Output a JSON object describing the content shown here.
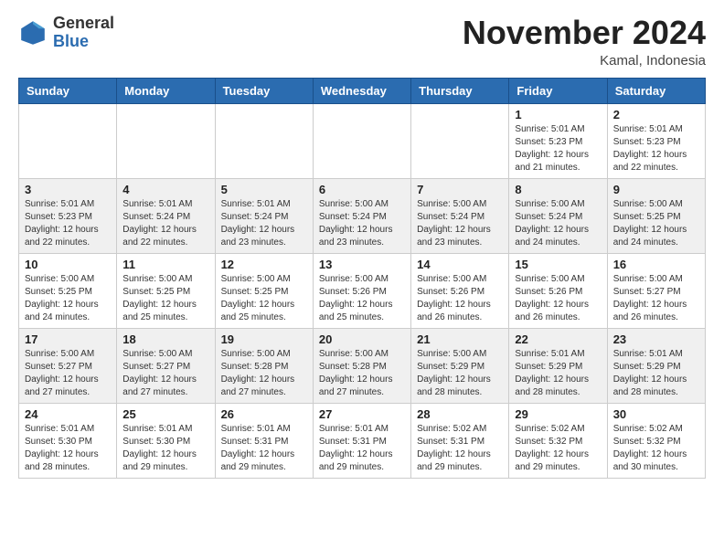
{
  "header": {
    "logo_general": "General",
    "logo_blue": "Blue",
    "month_title": "November 2024",
    "location": "Kamal, Indonesia"
  },
  "weekdays": [
    "Sunday",
    "Monday",
    "Tuesday",
    "Wednesday",
    "Thursday",
    "Friday",
    "Saturday"
  ],
  "weeks": [
    [
      {
        "day": "",
        "info": ""
      },
      {
        "day": "",
        "info": ""
      },
      {
        "day": "",
        "info": ""
      },
      {
        "day": "",
        "info": ""
      },
      {
        "day": "",
        "info": ""
      },
      {
        "day": "1",
        "info": "Sunrise: 5:01 AM\nSunset: 5:23 PM\nDaylight: 12 hours\nand 21 minutes."
      },
      {
        "day": "2",
        "info": "Sunrise: 5:01 AM\nSunset: 5:23 PM\nDaylight: 12 hours\nand 22 minutes."
      }
    ],
    [
      {
        "day": "3",
        "info": "Sunrise: 5:01 AM\nSunset: 5:23 PM\nDaylight: 12 hours\nand 22 minutes."
      },
      {
        "day": "4",
        "info": "Sunrise: 5:01 AM\nSunset: 5:24 PM\nDaylight: 12 hours\nand 22 minutes."
      },
      {
        "day": "5",
        "info": "Sunrise: 5:01 AM\nSunset: 5:24 PM\nDaylight: 12 hours\nand 23 minutes."
      },
      {
        "day": "6",
        "info": "Sunrise: 5:00 AM\nSunset: 5:24 PM\nDaylight: 12 hours\nand 23 minutes."
      },
      {
        "day": "7",
        "info": "Sunrise: 5:00 AM\nSunset: 5:24 PM\nDaylight: 12 hours\nand 23 minutes."
      },
      {
        "day": "8",
        "info": "Sunrise: 5:00 AM\nSunset: 5:24 PM\nDaylight: 12 hours\nand 24 minutes."
      },
      {
        "day": "9",
        "info": "Sunrise: 5:00 AM\nSunset: 5:25 PM\nDaylight: 12 hours\nand 24 minutes."
      }
    ],
    [
      {
        "day": "10",
        "info": "Sunrise: 5:00 AM\nSunset: 5:25 PM\nDaylight: 12 hours\nand 24 minutes."
      },
      {
        "day": "11",
        "info": "Sunrise: 5:00 AM\nSunset: 5:25 PM\nDaylight: 12 hours\nand 25 minutes."
      },
      {
        "day": "12",
        "info": "Sunrise: 5:00 AM\nSunset: 5:25 PM\nDaylight: 12 hours\nand 25 minutes."
      },
      {
        "day": "13",
        "info": "Sunrise: 5:00 AM\nSunset: 5:26 PM\nDaylight: 12 hours\nand 25 minutes."
      },
      {
        "day": "14",
        "info": "Sunrise: 5:00 AM\nSunset: 5:26 PM\nDaylight: 12 hours\nand 26 minutes."
      },
      {
        "day": "15",
        "info": "Sunrise: 5:00 AM\nSunset: 5:26 PM\nDaylight: 12 hours\nand 26 minutes."
      },
      {
        "day": "16",
        "info": "Sunrise: 5:00 AM\nSunset: 5:27 PM\nDaylight: 12 hours\nand 26 minutes."
      }
    ],
    [
      {
        "day": "17",
        "info": "Sunrise: 5:00 AM\nSunset: 5:27 PM\nDaylight: 12 hours\nand 27 minutes."
      },
      {
        "day": "18",
        "info": "Sunrise: 5:00 AM\nSunset: 5:27 PM\nDaylight: 12 hours\nand 27 minutes."
      },
      {
        "day": "19",
        "info": "Sunrise: 5:00 AM\nSunset: 5:28 PM\nDaylight: 12 hours\nand 27 minutes."
      },
      {
        "day": "20",
        "info": "Sunrise: 5:00 AM\nSunset: 5:28 PM\nDaylight: 12 hours\nand 27 minutes."
      },
      {
        "day": "21",
        "info": "Sunrise: 5:00 AM\nSunset: 5:29 PM\nDaylight: 12 hours\nand 28 minutes."
      },
      {
        "day": "22",
        "info": "Sunrise: 5:01 AM\nSunset: 5:29 PM\nDaylight: 12 hours\nand 28 minutes."
      },
      {
        "day": "23",
        "info": "Sunrise: 5:01 AM\nSunset: 5:29 PM\nDaylight: 12 hours\nand 28 minutes."
      }
    ],
    [
      {
        "day": "24",
        "info": "Sunrise: 5:01 AM\nSunset: 5:30 PM\nDaylight: 12 hours\nand 28 minutes."
      },
      {
        "day": "25",
        "info": "Sunrise: 5:01 AM\nSunset: 5:30 PM\nDaylight: 12 hours\nand 29 minutes."
      },
      {
        "day": "26",
        "info": "Sunrise: 5:01 AM\nSunset: 5:31 PM\nDaylight: 12 hours\nand 29 minutes."
      },
      {
        "day": "27",
        "info": "Sunrise: 5:01 AM\nSunset: 5:31 PM\nDaylight: 12 hours\nand 29 minutes."
      },
      {
        "day": "28",
        "info": "Sunrise: 5:02 AM\nSunset: 5:31 PM\nDaylight: 12 hours\nand 29 minutes."
      },
      {
        "day": "29",
        "info": "Sunrise: 5:02 AM\nSunset: 5:32 PM\nDaylight: 12 hours\nand 29 minutes."
      },
      {
        "day": "30",
        "info": "Sunrise: 5:02 AM\nSunset: 5:32 PM\nDaylight: 12 hours\nand 30 minutes."
      }
    ]
  ]
}
